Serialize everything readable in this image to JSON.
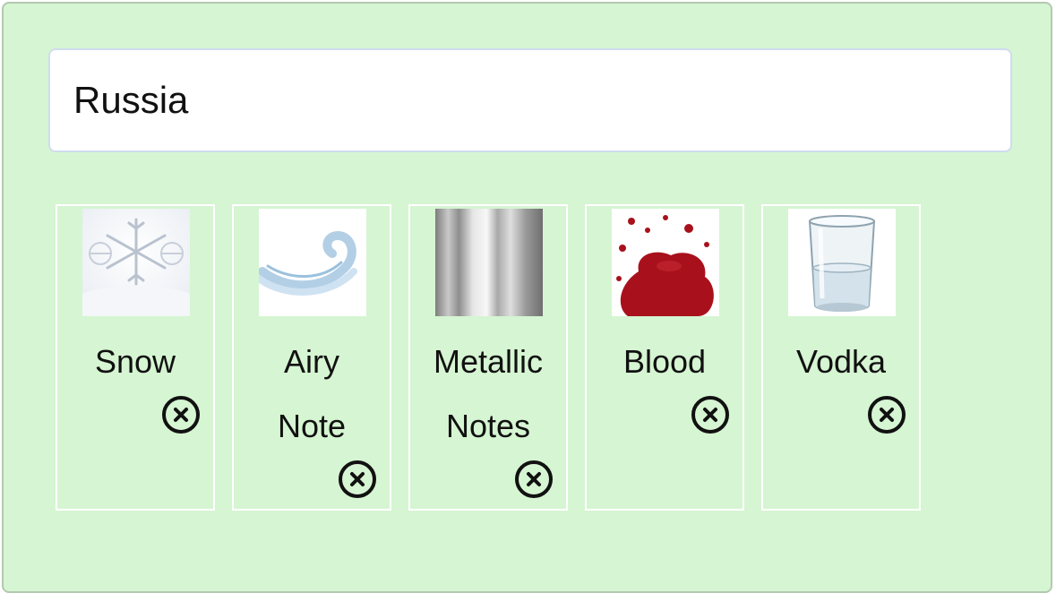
{
  "search": {
    "value": "Russia"
  },
  "tags": [
    {
      "label": "Snow",
      "icon": "snowflake-image-icon"
    },
    {
      "label": "Airy Note",
      "icon": "air-swirl-image-icon"
    },
    {
      "label": "Metallic Notes",
      "icon": "metal-texture-image-icon"
    },
    {
      "label": "Blood",
      "icon": "blood-splatter-image-icon"
    },
    {
      "label": "Vodka",
      "icon": "glass-of-vodka-image-icon"
    }
  ],
  "colors": {
    "panel_bg": "#d6f5d2",
    "card_border": "#ffffff",
    "blood": "#a8111c"
  }
}
